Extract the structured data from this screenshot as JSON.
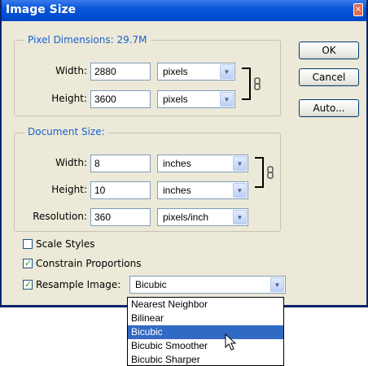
{
  "dialog": {
    "title": "Image Size",
    "close_glyph": "×"
  },
  "pixel_dimensions": {
    "legend": "Pixel Dimensions:  29.7M",
    "width_label": "Width:",
    "width_value": "2880",
    "width_unit": "pixels",
    "height_label": "Height:",
    "height_value": "3600",
    "height_unit": "pixels"
  },
  "document_size": {
    "legend": "Document Size:",
    "width_label": "Width:",
    "width_value": "8",
    "width_unit": "inches",
    "height_label": "Height:",
    "height_value": "10",
    "height_unit": "inches",
    "resolution_label": "Resolution:",
    "resolution_value": "360",
    "resolution_unit": "pixels/inch"
  },
  "buttons": {
    "ok": "OK",
    "cancel": "Cancel",
    "auto": "Auto..."
  },
  "options": {
    "scale_styles": {
      "label": "Scale Styles",
      "checked": false
    },
    "constrain_proportions": {
      "label": "Constrain Proportions",
      "checked": true
    },
    "resample_image": {
      "label": "Resample Image:",
      "checked": true,
      "value": "Bicubic"
    }
  },
  "resample_menu": {
    "items": [
      "Nearest Neighbor",
      "Bilinear",
      "Bicubic",
      "Bicubic Smoother",
      "Bicubic Sharper"
    ],
    "selected": "Bicubic"
  },
  "icons": {
    "dropdown_arrow": "▼",
    "check": "✓",
    "link": "chain-link-icon",
    "cursor": "mouse-pointer-icon"
  },
  "colors": {
    "titlebar": "#0757d9",
    "dialog_bg": "#ece9d8",
    "legend_text": "#1a5fcc",
    "selection": "#316ac5"
  }
}
